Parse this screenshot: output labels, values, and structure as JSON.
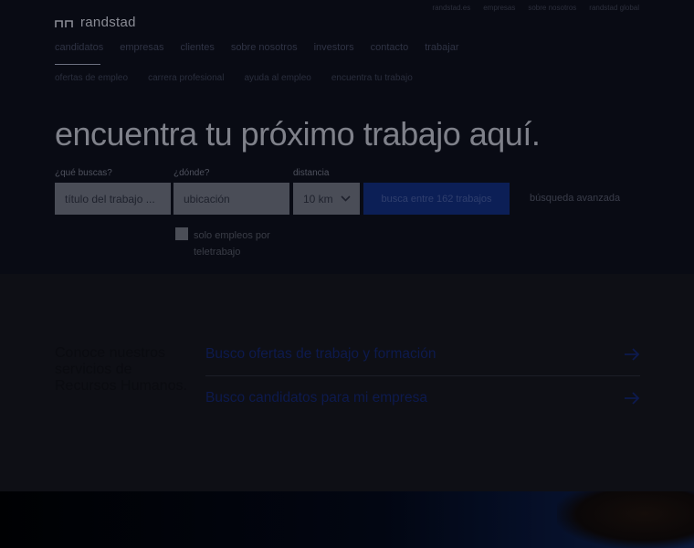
{
  "header": {
    "logo_text": "randstad",
    "utility_links": [
      "randstad.es",
      "empresas",
      "sobre nosotros",
      "randstad global"
    ],
    "main_nav": [
      "candidatos",
      "empresas",
      "clientes",
      "sobre nosotros",
      "investors",
      "contacto",
      "trabajar"
    ],
    "sub_nav": [
      "ofertas de empleo",
      "carrera profesional",
      "ayuda al empleo",
      "encuentra tu trabajo"
    ]
  },
  "hero": {
    "headline": "encuentra tu próximo trabajo aquí.",
    "what_label": "¿qué buscas?",
    "what_placeholder": "título del trabajo ...",
    "where_label": "¿dónde?",
    "where_placeholder": "ubicación",
    "distance_label": "distancia",
    "distance_value": "10 km",
    "search_button": "busca entre 162 trabajos",
    "advanced_search": "búsqueda avanzada",
    "remote_checkbox_label": "solo empleos por teletrabajo"
  },
  "services": {
    "title": "Conoce nuestros servicios de Recursos Humanos.",
    "links": [
      {
        "label": "Busco ofertas de trabajo y formación"
      },
      {
        "label": "Busco candidatos para mi empresa"
      }
    ]
  },
  "colors": {
    "brand_blue": "#2175d9",
    "overlay": "#0d0e13"
  }
}
